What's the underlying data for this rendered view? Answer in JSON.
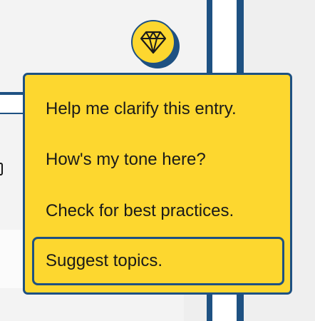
{
  "assistant": {
    "trigger_icon": "diamond-icon",
    "menu": {
      "items": [
        {
          "label": "Help me clarify this entry.",
          "selected": false
        },
        {
          "label": "How's my tone here?",
          "selected": false
        },
        {
          "label": "Check for best practices.",
          "selected": false
        },
        {
          "label": "Suggest topics.",
          "selected": true
        }
      ]
    }
  },
  "colors": {
    "accent_yellow": "#fdd72f",
    "border_blue": "#1e5182",
    "text": "#1a1a1a"
  }
}
